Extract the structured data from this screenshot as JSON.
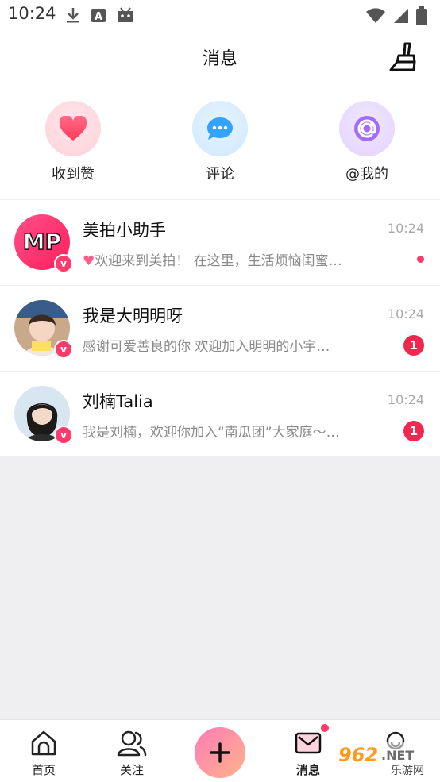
{
  "status_bar": {
    "time": "10:24",
    "icons": [
      "download-icon",
      "a-icon",
      "android-icon",
      "wifi-icon",
      "signal-icon",
      "battery-icon"
    ]
  },
  "header": {
    "title": "消息",
    "action_icon": "broom-icon"
  },
  "quick_actions": [
    {
      "label": "收到赞",
      "icon": "heart-icon",
      "color": "#ff4d6d"
    },
    {
      "label": "评论",
      "icon": "comment-icon",
      "color": "#35a6ff"
    },
    {
      "label": "@我的",
      "icon": "at-icon",
      "color": "#a46bff"
    }
  ],
  "messages": [
    {
      "name": "美拍小助手",
      "time": "10:24",
      "preview": "欢迎来到美拍！ 在这里，生活烦恼闺蜜…",
      "badge": "dot",
      "verified": true
    },
    {
      "name": "我是大明明呀",
      "time": "10:24",
      "preview": "感谢可爱善良的你 欢迎加入明明的小宇…",
      "badge": "1",
      "verified": true
    },
    {
      "name": "刘楠Talia",
      "time": "10:24",
      "preview": "我是刘楠，欢迎你加入“南瓜团”大家庭～…",
      "badge": "1",
      "verified": true
    }
  ],
  "tabbar": {
    "tabs": [
      {
        "label": "首页",
        "icon": "home-icon"
      },
      {
        "label": "关注",
        "icon": "users-icon"
      },
      {
        "label": "",
        "icon": "plus-icon"
      },
      {
        "label": "消息",
        "icon": "mail-icon"
      },
      {
        "label": "",
        "icon": "profile-icon"
      }
    ]
  },
  "watermark": {
    "line1": "962.NET",
    "line2": "乐游网"
  },
  "colors": {
    "accent": "#ff3b6b",
    "badge": "#f2274f"
  }
}
